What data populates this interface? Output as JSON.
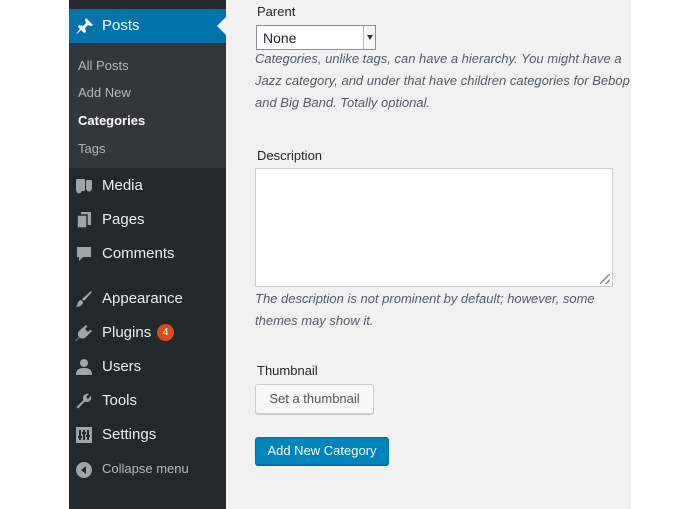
{
  "sidebar": {
    "posts": {
      "label": "Posts",
      "icon": "pushpin-icon"
    },
    "posts_submenu": [
      {
        "label": "All Posts",
        "current": false
      },
      {
        "label": "Add New",
        "current": false
      },
      {
        "label": "Categories",
        "current": true
      },
      {
        "label": "Tags",
        "current": false
      }
    ],
    "items": [
      {
        "label": "Media",
        "icon": "media-icon"
      },
      {
        "label": "Pages",
        "icon": "pages-icon"
      },
      {
        "label": "Comments",
        "icon": "comment-icon"
      },
      {
        "label": "Appearance",
        "icon": "paintbrush-icon"
      },
      {
        "label": "Plugins",
        "icon": "plugin-icon",
        "badge": "4"
      },
      {
        "label": "Users",
        "icon": "user-icon"
      },
      {
        "label": "Tools",
        "icon": "wrench-icon"
      },
      {
        "label": "Settings",
        "icon": "settings-icon"
      }
    ],
    "collapse_label": "Collapse menu"
  },
  "form": {
    "parent": {
      "label": "Parent",
      "value": "None",
      "help": "Categories, unlike tags, can have a hierarchy. You might have a Jazz category, and under that have children categories for Bebop and Big Band. Totally optional."
    },
    "description": {
      "label": "Description",
      "value": "",
      "help": "The description is not prominent by default; however, some themes may show it."
    },
    "thumbnail": {
      "label": "Thumbnail",
      "button": "Set a thumbnail"
    },
    "submit": "Add New Category"
  },
  "colors": {
    "sidebar_bg": "#23282d",
    "submenu_bg": "#32373c",
    "active_bg": "#0073aa",
    "primary_button": "#0085ba",
    "badge": "#d54e21",
    "content_bg": "#f1f1f1"
  }
}
